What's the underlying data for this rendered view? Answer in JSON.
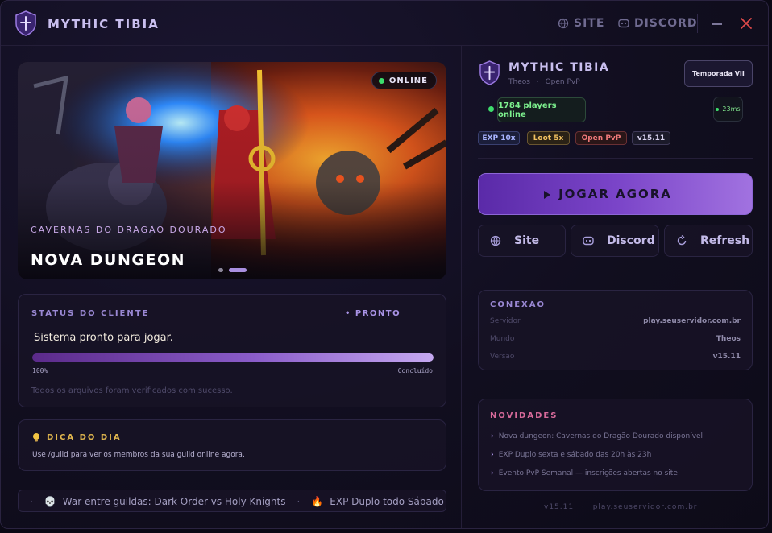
{
  "app": {
    "title": "MYTHIC TIBIA",
    "site_label": "SITE",
    "discord_label": "DISCORD"
  },
  "hero": {
    "status": "ONLINE",
    "subtitle": "CAVERNAS DO DRAGÃO DOURADO",
    "title": "NOVA DUNGEON"
  },
  "client_status": {
    "label": "STATUS DO CLIENTE",
    "state": "• PRONTO",
    "message": "Sistema pronto para jogar.",
    "progress": 1.0,
    "progress_label": "100%",
    "progress_state": "Concluído",
    "note": "Todos os arquivos foram verificados com sucesso."
  },
  "tip": {
    "label": "DICA DO DIA",
    "text": "Use /guild para ver os membros da sua guild online agora."
  },
  "ticker": {
    "items": [
      {
        "icon": "skull-icon",
        "glyph": "💀",
        "text": "War entre guildas: Dark Order vs Holy Knights"
      },
      {
        "icon": "fire-icon",
        "glyph": "🔥",
        "text": "EXP Duplo todo Sábado e Domingo"
      }
    ]
  },
  "server": {
    "name": "MYTHIC TIBIA",
    "world": "Theos",
    "mode": "Open PvP",
    "separator": "·",
    "season": "Temporada VII",
    "players": "1784 players online",
    "ping": "23ms",
    "tags": [
      {
        "label": "EXP 10x",
        "color": "#a9b4ff",
        "bg": "#1b1e3a",
        "border": "#3a4070"
      },
      {
        "label": "Loot 5x",
        "color": "#f0c060",
        "bg": "#2a2216",
        "border": "#6a5630"
      },
      {
        "label": "Open PvP",
        "color": "#f07a7a",
        "bg": "#2a1618",
        "border": "#6a3034"
      },
      {
        "label": "v15.11",
        "color": "#d7d2ee",
        "bg": "#1b1a2a",
        "border": "#3f3a58"
      }
    ]
  },
  "actions": {
    "play": "JOGAR AGORA",
    "site": "Site",
    "discord": "Discord",
    "refresh": "Refresh"
  },
  "connection": {
    "label": "CONEXÃO",
    "rows": [
      {
        "key": "Servidor",
        "value": "play.seuservidor.com.br"
      },
      {
        "key": "Mundo",
        "value": "Theos"
      },
      {
        "key": "Versão",
        "value": "v15.11"
      }
    ]
  },
  "news": {
    "label": "NOVIDADES",
    "items": [
      "Nova dungeon: Cavernas do Dragão Dourado disponível",
      "EXP Duplo sexta e sábado das 20h às 23h",
      "Evento PvP Semanal — inscrições abertas no site"
    ]
  },
  "footer": {
    "version": "v15.11",
    "separator": "·",
    "host": "play.seuservidor.com.br"
  },
  "colors": {
    "accent": "#8a5cc9",
    "online": "#3ddc6c",
    "close": "#e04a4a"
  }
}
